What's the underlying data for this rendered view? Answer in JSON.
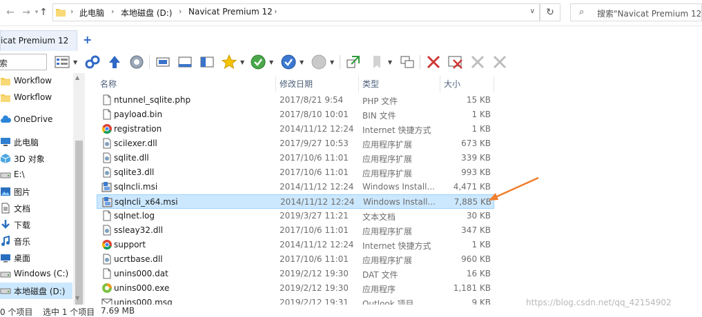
{
  "address": {
    "breadcrumbs": [
      "此电脑",
      "本地磁盘 (D:)",
      "Navicat Premium 12"
    ],
    "search_placeholder": "搜索\"Navicat Premium 12\""
  },
  "tab": {
    "label": "icat Premium 12"
  },
  "toolbar": {
    "filter_text": "索"
  },
  "nav": {
    "items": [
      {
        "label": "Workflow",
        "icon": "folder-icon"
      },
      {
        "label": "Workflow",
        "icon": "folder-icon"
      },
      {
        "label": "OneDrive",
        "icon": "cloud-icon"
      },
      {
        "label": "此电脑",
        "icon": "computer-icon"
      },
      {
        "label": "3D 对象",
        "icon": "3d-objects-icon"
      },
      {
        "label": "E:\\",
        "icon": "drive-icon"
      },
      {
        "label": "图片",
        "icon": "pictures-icon"
      },
      {
        "label": "文档",
        "icon": "documents-icon"
      },
      {
        "label": "下载",
        "icon": "downloads-icon"
      },
      {
        "label": "音乐",
        "icon": "music-icon"
      },
      {
        "label": "桌面",
        "icon": "desktop-icon"
      },
      {
        "label": "Windows (C:)",
        "icon": "drive-icon"
      },
      {
        "label": "本地磁盘 (D:)",
        "icon": "drive-icon"
      }
    ]
  },
  "columns": {
    "name": "名称",
    "date": "修改日期",
    "type": "类型",
    "size": "大小"
  },
  "files": [
    {
      "name": "ntunnel_sqlite.php",
      "date": "2017/8/21 9:54",
      "type": "PHP 文件",
      "size": "15 KB",
      "icon": "file-icon"
    },
    {
      "name": "payload.bin",
      "date": "2017/8/10 10:01",
      "type": "BIN 文件",
      "size": "1 KB",
      "icon": "file-icon"
    },
    {
      "name": "registration",
      "date": "2014/11/12 12:24",
      "type": "Internet 快捷方式",
      "size": "1 KB",
      "icon": "chrome-icon"
    },
    {
      "name": "scilexer.dll",
      "date": "2017/9/27 10:53",
      "type": "应用程序扩展",
      "size": "673 KB",
      "icon": "dll-icon"
    },
    {
      "name": "sqlite.dll",
      "date": "2017/10/6 11:01",
      "type": "应用程序扩展",
      "size": "339 KB",
      "icon": "dll-icon"
    },
    {
      "name": "sqlite3.dll",
      "date": "2017/10/6 11:01",
      "type": "应用程序扩展",
      "size": "993 KB",
      "icon": "dll-icon"
    },
    {
      "name": "sqlncli.msi",
      "date": "2014/11/12 12:24",
      "type": "Windows Install...",
      "size": "4,471 KB",
      "icon": "msi-icon"
    },
    {
      "name": "sqlncli_x64.msi",
      "date": "2014/11/12 12:24",
      "type": "Windows Install...",
      "size": "7,885 KB",
      "icon": "msi-icon",
      "selected": true
    },
    {
      "name": "sqlnet.log",
      "date": "2019/3/27 11:21",
      "type": "文本文档",
      "size": "30 KB",
      "icon": "file-icon"
    },
    {
      "name": "ssleay32.dll",
      "date": "2017/10/6 11:01",
      "type": "应用程序扩展",
      "size": "347 KB",
      "icon": "dll-icon"
    },
    {
      "name": "support",
      "date": "2014/11/12 12:24",
      "type": "Internet 快捷方式",
      "size": "1 KB",
      "icon": "chrome-icon"
    },
    {
      "name": "ucrtbase.dll",
      "date": "2017/10/6 11:01",
      "type": "应用程序扩展",
      "size": "960 KB",
      "icon": "dll-icon"
    },
    {
      "name": "unins000.dat",
      "date": "2019/2/12 19:30",
      "type": "DAT 文件",
      "size": "16 KB",
      "icon": "file-icon"
    },
    {
      "name": "unins000.exe",
      "date": "2019/2/12 19:30",
      "type": "应用程序",
      "size": "1,181 KB",
      "icon": "installer-icon"
    },
    {
      "name": "unins000.msg",
      "date": "2019/2/12 19:31",
      "type": "Outlook 项目",
      "size": "9 KB",
      "icon": "mail-icon"
    }
  ],
  "status": {
    "count": "0 个项目",
    "selected": "选中 1 个项目",
    "size": "7.69 MB"
  },
  "watermark": "https://blog.csdn.net/qq_42154902",
  "colors": {
    "selection": "#cce8ff",
    "selection_border": "#99d1ff",
    "arrow": "#f07d2a",
    "header_text": "#4c607a"
  }
}
